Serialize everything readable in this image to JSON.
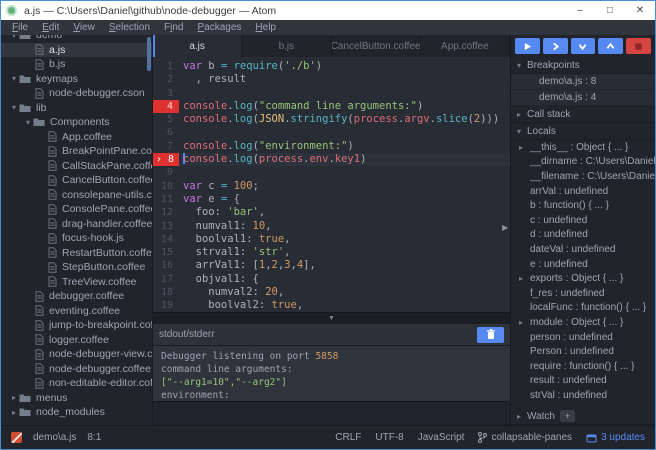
{
  "window": {
    "title": "a.js — C:\\Users\\Daniel\\github\\node-debugger — Atom",
    "minimize_label": "–",
    "maximize_label": "□",
    "close_label": "✕"
  },
  "menu": {
    "items": [
      {
        "label": "File",
        "accel": 0
      },
      {
        "label": "Edit",
        "accel": 0
      },
      {
        "label": "View",
        "accel": 0
      },
      {
        "label": "Selection",
        "accel": 0
      },
      {
        "label": "Find",
        "accel": 1
      },
      {
        "label": "Packages",
        "accel": 0
      },
      {
        "label": "Help",
        "accel": 0
      }
    ]
  },
  "tree": {
    "items": [
      {
        "label": "demo",
        "level": 0,
        "kind": "folder-open"
      },
      {
        "label": "a.js",
        "level": 1,
        "kind": "file",
        "selected": true
      },
      {
        "label": "b.js",
        "level": 1,
        "kind": "file"
      },
      {
        "label": "keymaps",
        "level": 0,
        "kind": "folder-open"
      },
      {
        "label": "node-debugger.cson",
        "level": 1,
        "kind": "file"
      },
      {
        "label": "lib",
        "level": 0,
        "kind": "folder-open"
      },
      {
        "label": "Components",
        "level": 1,
        "kind": "folder-open"
      },
      {
        "label": "App.coffee",
        "level": 2,
        "kind": "file"
      },
      {
        "label": "BreakPointPane.coffee",
        "level": 2,
        "kind": "file"
      },
      {
        "label": "CallStackPane.coffee",
        "level": 2,
        "kind": "file"
      },
      {
        "label": "CancelButton.coffee",
        "level": 2,
        "kind": "file"
      },
      {
        "label": "consolepane-utils.coffee",
        "level": 2,
        "kind": "file"
      },
      {
        "label": "ConsolePane.coffee",
        "level": 2,
        "kind": "file"
      },
      {
        "label": "drag-handler.coffee",
        "level": 2,
        "kind": "file"
      },
      {
        "label": "focus-hook.js",
        "level": 2,
        "kind": "file"
      },
      {
        "label": "RestartButton.coffee",
        "level": 2,
        "kind": "file"
      },
      {
        "label": "StepButton.coffee",
        "level": 2,
        "kind": "file"
      },
      {
        "label": "TreeView.coffee",
        "level": 2,
        "kind": "file"
      },
      {
        "label": "debugger.coffee",
        "level": 1,
        "kind": "file"
      },
      {
        "label": "eventing.coffee",
        "level": 1,
        "kind": "file"
      },
      {
        "label": "jump-to-breakpoint.coffee",
        "level": 1,
        "kind": "file"
      },
      {
        "label": "logger.coffee",
        "level": 1,
        "kind": "file"
      },
      {
        "label": "node-debugger-view.coffee",
        "level": 1,
        "kind": "file"
      },
      {
        "label": "node-debugger.coffee",
        "level": 1,
        "kind": "file"
      },
      {
        "label": "non-editable-editor.coffee",
        "level": 1,
        "kind": "file"
      },
      {
        "label": "menus",
        "level": 0,
        "kind": "folder-closed"
      },
      {
        "label": "node_modules",
        "level": 0,
        "kind": "folder-closed"
      }
    ]
  },
  "tabs": {
    "items": [
      {
        "label": "a.js",
        "active": true
      },
      {
        "label": "b.js",
        "active": false
      },
      {
        "label": "CancelButton.coffee",
        "active": false
      },
      {
        "label": "App.coffee",
        "active": false
      }
    ]
  },
  "editor": {
    "cursor_line": 8,
    "lines": [
      {
        "num": 1,
        "gutter": "normal",
        "tokens": [
          [
            "k",
            "var"
          ],
          [
            "v",
            " b "
          ],
          [
            "o",
            "="
          ],
          [
            "v",
            " "
          ],
          [
            "f",
            "require"
          ],
          [
            "v",
            "("
          ],
          [
            "s",
            "'./b'"
          ],
          [
            "v",
            ")"
          ]
        ]
      },
      {
        "num": 2,
        "gutter": "normal",
        "tokens": [
          [
            "v",
            "  , result"
          ]
        ]
      },
      {
        "num": 3,
        "gutter": "normal",
        "tokens": []
      },
      {
        "num": 4,
        "gutter": "breakpoint",
        "tokens": [
          [
            "r",
            "console"
          ],
          [
            "v",
            "."
          ],
          [
            "f",
            "log"
          ],
          [
            "v",
            "("
          ],
          [
            "s",
            "\"command line arguments:\""
          ],
          [
            "v",
            ")"
          ]
        ]
      },
      {
        "num": 5,
        "gutter": "normal",
        "tokens": [
          [
            "r",
            "console"
          ],
          [
            "v",
            "."
          ],
          [
            "f",
            "log"
          ],
          [
            "v",
            "("
          ],
          [
            "c",
            "JSON"
          ],
          [
            "v",
            "."
          ],
          [
            "f",
            "stringify"
          ],
          [
            "v",
            "("
          ],
          [
            "r",
            "process"
          ],
          [
            "v",
            "."
          ],
          [
            "r",
            "argv"
          ],
          [
            "v",
            "."
          ],
          [
            "f",
            "slice"
          ],
          [
            "v",
            "("
          ],
          [
            "n",
            "2"
          ],
          [
            "v",
            ")))"
          ]
        ]
      },
      {
        "num": 6,
        "gutter": "normal",
        "tokens": []
      },
      {
        "num": 7,
        "gutter": "normal",
        "tokens": [
          [
            "r",
            "console"
          ],
          [
            "v",
            "."
          ],
          [
            "f",
            "log"
          ],
          [
            "v",
            "("
          ],
          [
            "s",
            "\"environment:\""
          ],
          [
            "v",
            ")"
          ]
        ]
      },
      {
        "num": 8,
        "gutter": "current",
        "tokens": [
          [
            "r",
            "console"
          ],
          [
            "v",
            "."
          ],
          [
            "f",
            "log"
          ],
          [
            "v",
            "("
          ],
          [
            "r",
            "process"
          ],
          [
            "v",
            "."
          ],
          [
            "r",
            "env"
          ],
          [
            "v",
            "."
          ],
          [
            "r",
            "key1"
          ],
          [
            "v",
            ")"
          ]
        ]
      },
      {
        "num": 9,
        "gutter": "normal",
        "tokens": []
      },
      {
        "num": 10,
        "gutter": "normal",
        "tokens": [
          [
            "k",
            "var"
          ],
          [
            "v",
            " c "
          ],
          [
            "o",
            "="
          ],
          [
            "n",
            " 100"
          ],
          [
            "v",
            ";"
          ]
        ]
      },
      {
        "num": 11,
        "gutter": "normal",
        "tokens": [
          [
            "k",
            "var"
          ],
          [
            "v",
            " e "
          ],
          [
            "o",
            "="
          ],
          [
            "v",
            " {"
          ]
        ]
      },
      {
        "num": 12,
        "gutter": "normal",
        "tokens": [
          [
            "v",
            "  foo: "
          ],
          [
            "s",
            "'bar'"
          ],
          [
            "v",
            ","
          ]
        ]
      },
      {
        "num": 13,
        "gutter": "normal",
        "tokens": [
          [
            "v",
            "  numval1: "
          ],
          [
            "n",
            "10"
          ],
          [
            "v",
            ","
          ]
        ]
      },
      {
        "num": 14,
        "gutter": "normal",
        "tokens": [
          [
            "v",
            "  boolval1: "
          ],
          [
            "n",
            "true"
          ],
          [
            "v",
            ","
          ]
        ]
      },
      {
        "num": 15,
        "gutter": "normal",
        "tokens": [
          [
            "v",
            "  strval1: "
          ],
          [
            "s",
            "'str'"
          ],
          [
            "v",
            ","
          ]
        ]
      },
      {
        "num": 16,
        "gutter": "normal",
        "tokens": [
          [
            "v",
            "  arrVal1: ["
          ],
          [
            "n",
            "1"
          ],
          [
            "v",
            ","
          ],
          [
            "n",
            "2"
          ],
          [
            "v",
            ","
          ],
          [
            "n",
            "3"
          ],
          [
            "v",
            ","
          ],
          [
            "n",
            "4"
          ],
          [
            "v",
            "],"
          ]
        ]
      },
      {
        "num": 17,
        "gutter": "normal",
        "tokens": [
          [
            "v",
            "  objval1: {"
          ]
        ]
      },
      {
        "num": 18,
        "gutter": "normal",
        "tokens": [
          [
            "v",
            "    numval2: "
          ],
          [
            "n",
            "20"
          ],
          [
            "v",
            ","
          ]
        ]
      },
      {
        "num": 19,
        "gutter": "normal",
        "tokens": [
          [
            "v",
            "    boolval2: "
          ],
          [
            "n",
            "true"
          ],
          [
            "v",
            ","
          ]
        ]
      }
    ],
    "current_line_marker": "›"
  },
  "output": {
    "title": "stdout/stderr",
    "lines": [
      {
        "tokens": [
          [
            "t",
            "Debugger listening on port "
          ],
          [
            "n",
            "5858"
          ]
        ]
      },
      {
        "tokens": [
          [
            "t",
            "command line arguments:"
          ]
        ]
      },
      {
        "tokens": [
          [
            "s",
            "[\"--arg1=10\",\"--arg2\"]"
          ]
        ]
      },
      {
        "tokens": [
          [
            "t",
            "environment:"
          ]
        ]
      }
    ]
  },
  "debug": {
    "buttons": [
      {
        "name": "continue",
        "icon": "play"
      },
      {
        "name": "step-over",
        "icon": "chevron-right"
      },
      {
        "name": "step-into",
        "icon": "chevron-down"
      },
      {
        "name": "step-out",
        "icon": "chevron-up"
      },
      {
        "name": "stop",
        "icon": "stop"
      }
    ],
    "breakpoints": {
      "title": "Breakpoints",
      "expanded": true,
      "items": [
        "demo\\a.js : 8",
        "demo\\a.js : 4"
      ]
    },
    "call_stack": {
      "title": "Call stack",
      "expanded": false
    },
    "locals": {
      "title": "Locals",
      "expanded": true,
      "items": [
        {
          "text": "__this__ : Object { ... }",
          "expandable": true
        },
        {
          "text": "__dirname : C:\\Users\\Daniel\\github\\",
          "expandable": false
        },
        {
          "text": "__filename : C:\\Users\\Daniel\\github",
          "expandable": false
        },
        {
          "text": "arrVal : undefined",
          "expandable": false
        },
        {
          "text": "b : function() { ... }",
          "expandable": false
        },
        {
          "text": "c : undefined",
          "expandable": false
        },
        {
          "text": "d : undefined",
          "expandable": false
        },
        {
          "text": "dateVal : undefined",
          "expandable": false
        },
        {
          "text": "e : undefined",
          "expandable": false
        },
        {
          "text": "exports : Object { ... }",
          "expandable": true
        },
        {
          "text": "f_res : undefined",
          "expandable": false
        },
        {
          "text": "localFunc : function() { ... }",
          "expandable": false
        },
        {
          "text": "module : Object { ... }",
          "expandable": true
        },
        {
          "text": "person : undefined",
          "expandable": false
        },
        {
          "text": "Person : undefined",
          "expandable": false
        },
        {
          "text": "require : function() { ... }",
          "expandable": false
        },
        {
          "text": "result : undefined",
          "expandable": false
        },
        {
          "text": "strVal : undefined",
          "expandable": false
        }
      ]
    },
    "watch": {
      "title": "Watch",
      "expanded": false,
      "add_label": "+"
    }
  },
  "status": {
    "file": "demo\\a.js",
    "position": "8:1",
    "line_ending": "CRLF",
    "encoding": "UTF-8",
    "language": "JavaScript",
    "branch": "collapsable-panes",
    "updates": "3 updates"
  },
  "colors": {
    "accent": "#568af2",
    "stop_red": "#d64541",
    "breakpoint_red": "#e03131",
    "editor_bg": "#282c34",
    "panel_bg": "#21252b"
  }
}
